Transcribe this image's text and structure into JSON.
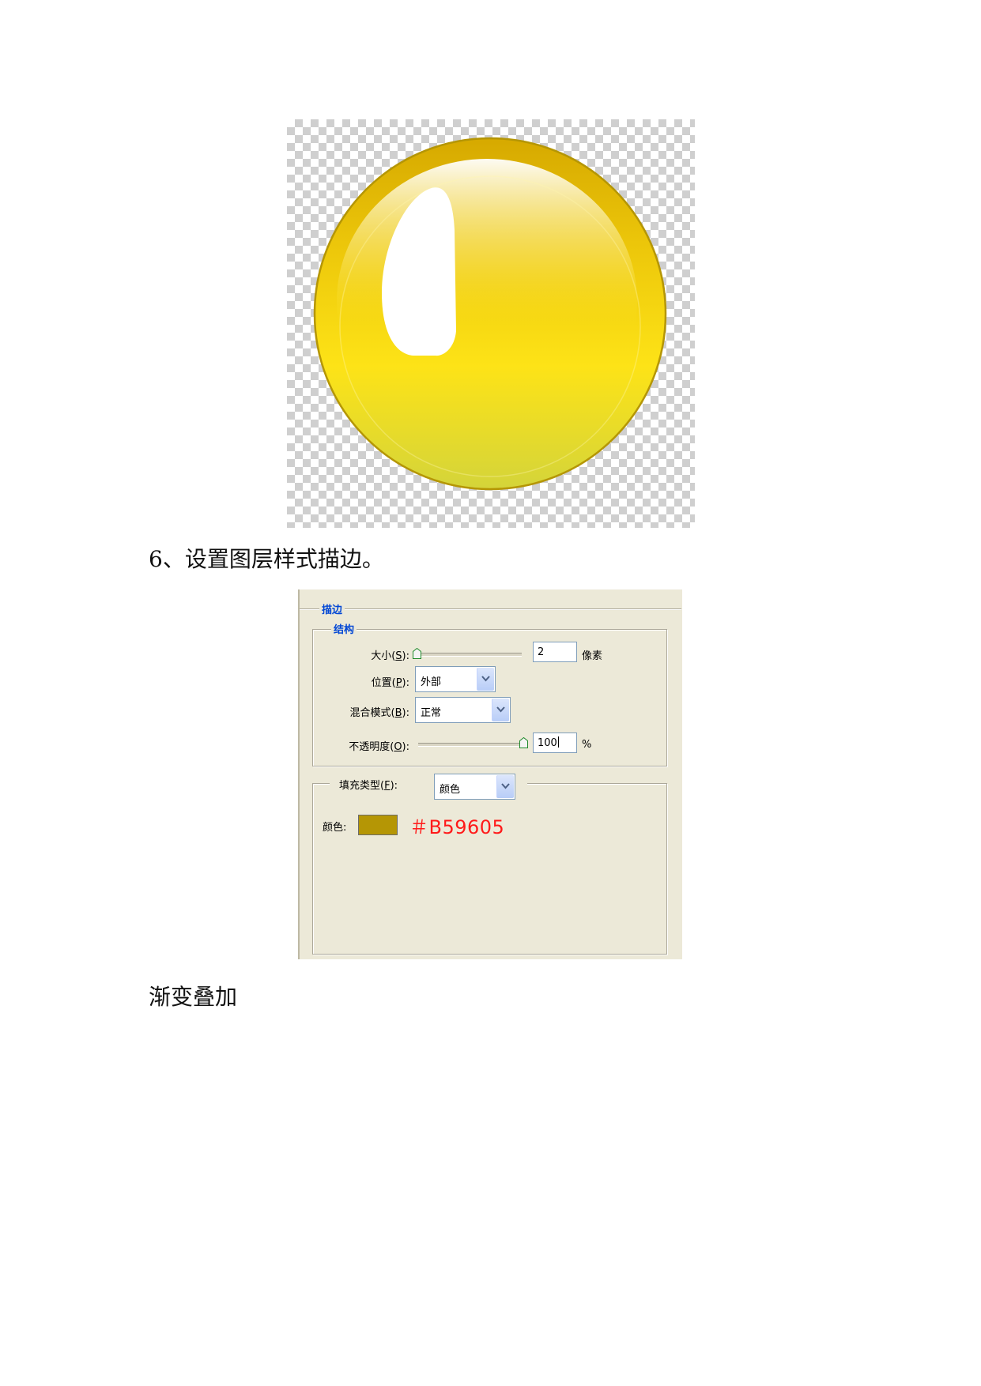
{
  "document": {
    "step_caption": "6、设置图层样式描边。",
    "next_caption": "渐变叠加"
  },
  "ball": {
    "top_color": "#d9ad00",
    "mid_color": "#fde317",
    "bottom_color": "#d8d63a",
    "rim_color": "#b59605",
    "highlight_color": "#ffffff"
  },
  "dialog": {
    "section_title": "描边",
    "structure_title": "结构",
    "size": {
      "label_pre": "大小(",
      "key": "S",
      "label_post": "):",
      "value": "2",
      "unit": "像素",
      "slider_fraction": 0.0
    },
    "position": {
      "label_pre": "位置(",
      "key": "P",
      "label_post": "):",
      "value": "外部"
    },
    "blend_mode": {
      "label_pre": "混合模式(",
      "key": "B",
      "label_post": "):",
      "value": "正常"
    },
    "opacity": {
      "label_pre": "不透明度(",
      "key": "O",
      "label_post": "):",
      "value": "100",
      "unit": "%",
      "slider_fraction": 1.0
    },
    "fill_type": {
      "label_pre": "填充类型(",
      "key": "F",
      "label_post": "):",
      "value": "颜色"
    },
    "color": {
      "label": "颜色:",
      "swatch": "#b59605",
      "annotation": "＃B59605",
      "annotation_color": "#ff1a1a"
    }
  }
}
